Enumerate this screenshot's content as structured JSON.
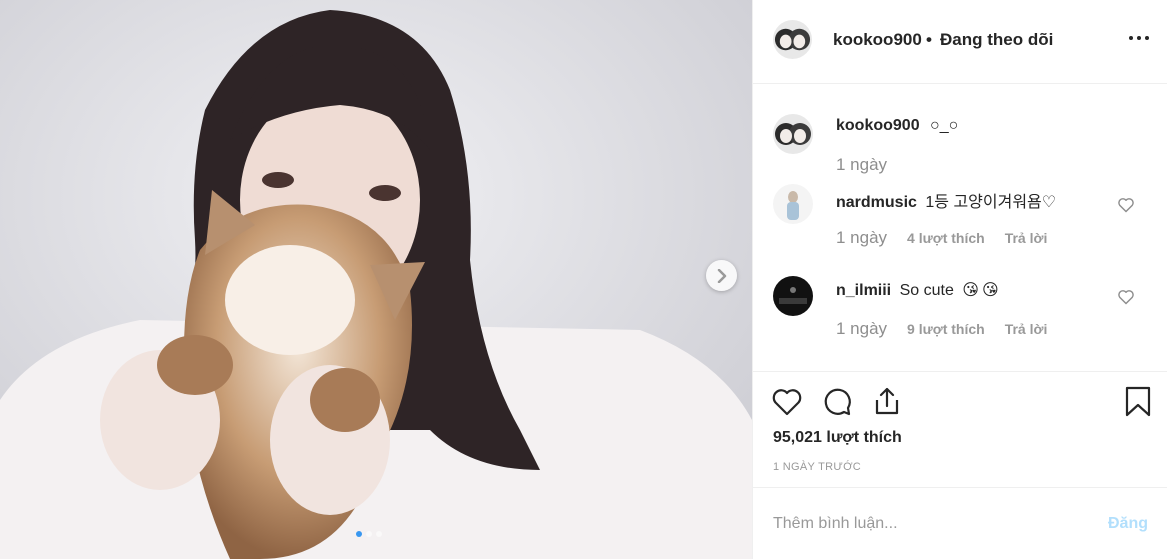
{
  "post": {
    "username": "kookoo900",
    "separator": "•",
    "follow_status": "Đang theo dõi",
    "more_icon": "more-options-icon",
    "media": {
      "description_icon": "photo",
      "slides_total": 3,
      "slide_active": 1,
      "next_icon": "chevron-right-icon"
    }
  },
  "caption": {
    "username": "kookoo900",
    "text": "○_○",
    "time": "1 ngày"
  },
  "comments": [
    {
      "username": "nardmusic",
      "text": "1등 고양이겨워욤♡",
      "time": "1 ngày",
      "likes": "4 lượt thích",
      "reply": "Trả lời"
    },
    {
      "username": "n_ilmiii",
      "text": "So cute",
      "emoji": [
        "😘",
        "😘"
      ],
      "time": "1 ngày",
      "likes": "9 lượt thích",
      "reply": "Trả lời"
    }
  ],
  "actions": {
    "like_icon": "heart-icon",
    "comment_icon": "comment-icon",
    "share_icon": "share-icon",
    "save_icon": "bookmark-icon",
    "likes_count": "95,021 lượt thích",
    "posted": "1 NGÀY TRƯỚC"
  },
  "comment_form": {
    "placeholder": "Thêm bình luận...",
    "submit_label": "Đăng"
  },
  "colors": {
    "accent": "#3897f0",
    "post_disabled": "#b2dffc",
    "muted": "#8e8e8e",
    "border": "#efefef"
  }
}
